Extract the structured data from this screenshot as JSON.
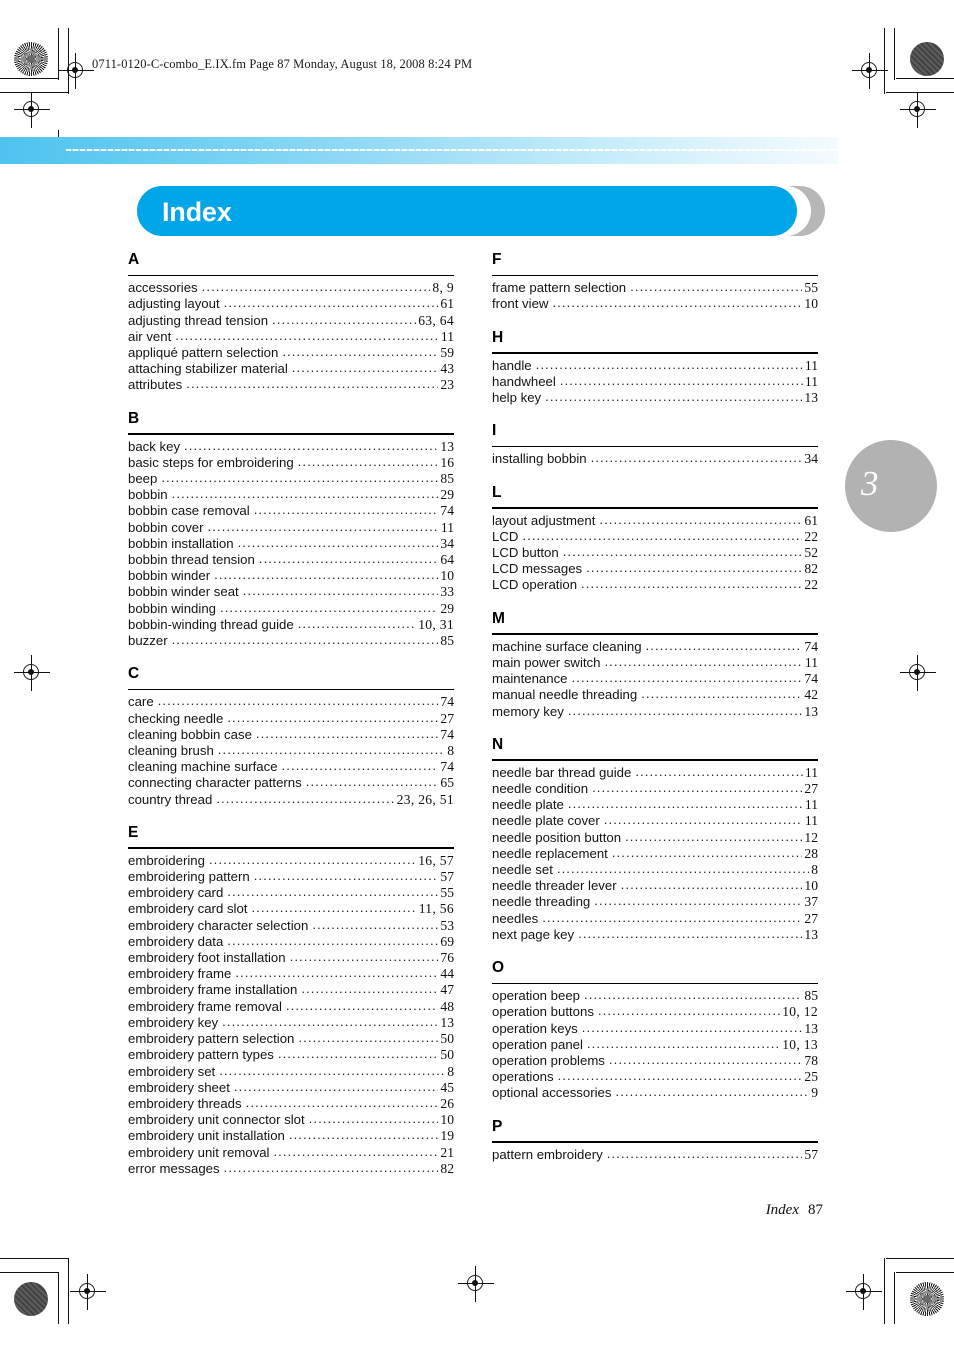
{
  "print_slug": "0711-0120-C-combo_E.IX.fm  Page 87  Monday, August 18, 2008  8:24 PM",
  "title": "Index",
  "chapter_marker": "3",
  "colors": {
    "title_bar": "#00a6e8",
    "title_shadow": "#b7b7b7",
    "gradient_start": "#4dc3ef",
    "gradient_end": "#f3fbfe",
    "chapter_bubble": "#b2b2b2"
  },
  "footer": {
    "label": "Index",
    "page_number": "87"
  },
  "columns": [
    {
      "letters": [
        {
          "letter": "A",
          "entries": [
            {
              "term": "accessories",
              "page": "8, 9"
            },
            {
              "term": "adjusting layout",
              "page": "61"
            },
            {
              "term": "adjusting thread tension",
              "page": "63, 64"
            },
            {
              "term": "air vent",
              "page": "11"
            },
            {
              "term": "appliqué pattern selection",
              "page": "59"
            },
            {
              "term": "attaching stabilizer material",
              "page": "43"
            },
            {
              "term": "attributes",
              "page": "23"
            }
          ]
        },
        {
          "letter": "B",
          "entries": [
            {
              "term": "back key",
              "page": "13"
            },
            {
              "term": "basic steps for embroidering",
              "page": "16"
            },
            {
              "term": "beep",
              "page": "85"
            },
            {
              "term": "bobbin",
              "page": "29"
            },
            {
              "term": "bobbin case removal",
              "page": "74"
            },
            {
              "term": "bobbin cover",
              "page": "11"
            },
            {
              "term": "bobbin installation",
              "page": "34"
            },
            {
              "term": "bobbin thread tension",
              "page": "64"
            },
            {
              "term": "bobbin winder",
              "page": "10"
            },
            {
              "term": "bobbin winder seat",
              "page": "33"
            },
            {
              "term": "bobbin winding",
              "page": "29"
            },
            {
              "term": "bobbin-winding thread guide",
              "page": "10, 31"
            },
            {
              "term": "buzzer",
              "page": "85"
            }
          ]
        },
        {
          "letter": "C",
          "entries": [
            {
              "term": "care",
              "page": "74"
            },
            {
              "term": "checking needle",
              "page": "27"
            },
            {
              "term": "cleaning bobbin case",
              "page": "74"
            },
            {
              "term": "cleaning brush",
              "page": "8"
            },
            {
              "term": "cleaning machine surface",
              "page": "74"
            },
            {
              "term": "connecting character patterns",
              "page": "65"
            },
            {
              "term": "country thread",
              "page": "23, 26, 51"
            }
          ]
        },
        {
          "letter": "E",
          "entries": [
            {
              "term": "embroidering",
              "page": "16, 57"
            },
            {
              "term": "embroidering pattern",
              "page": "57"
            },
            {
              "term": "embroidery card",
              "page": "55"
            },
            {
              "term": "embroidery card slot",
              "page": "11, 56"
            },
            {
              "term": "embroidery character selection",
              "page": "53"
            },
            {
              "term": "embroidery data",
              "page": "69"
            },
            {
              "term": "embroidery foot installation",
              "page": "76"
            },
            {
              "term": "embroidery frame",
              "page": "44"
            },
            {
              "term": "embroidery frame installation",
              "page": "47"
            },
            {
              "term": "embroidery frame removal",
              "page": "48"
            },
            {
              "term": "embroidery key",
              "page": "13"
            },
            {
              "term": "embroidery pattern selection",
              "page": "50"
            },
            {
              "term": "embroidery pattern types",
              "page": "50"
            },
            {
              "term": "embroidery set",
              "page": "8"
            },
            {
              "term": "embroidery sheet",
              "page": "45"
            },
            {
              "term": "embroidery threads",
              "page": "26"
            },
            {
              "term": "embroidery unit connector slot",
              "page": "10"
            },
            {
              "term": "embroidery unit installation",
              "page": "19"
            },
            {
              "term": "embroidery unit removal",
              "page": "21"
            },
            {
              "term": "error messages",
              "page": "82"
            }
          ]
        }
      ]
    },
    {
      "letters": [
        {
          "letter": "F",
          "entries": [
            {
              "term": "frame pattern selection",
              "page": "55"
            },
            {
              "term": "front view",
              "page": "10"
            }
          ]
        },
        {
          "letter": "H",
          "entries": [
            {
              "term": "handle",
              "page": "11"
            },
            {
              "term": "handwheel",
              "page": "11"
            },
            {
              "term": "help key",
              "page": "13"
            }
          ]
        },
        {
          "letter": "I",
          "entries": [
            {
              "term": "installing bobbin",
              "page": "34"
            }
          ]
        },
        {
          "letter": "L",
          "entries": [
            {
              "term": "layout adjustment",
              "page": "61"
            },
            {
              "term": "LCD",
              "page": "22"
            },
            {
              "term": "LCD button",
              "page": "52"
            },
            {
              "term": "LCD messages",
              "page": "82"
            },
            {
              "term": "LCD operation",
              "page": "22"
            }
          ]
        },
        {
          "letter": "M",
          "entries": [
            {
              "term": "machine surface cleaning",
              "page": "74"
            },
            {
              "term": "main power switch",
              "page": "11"
            },
            {
              "term": "maintenance",
              "page": "74"
            },
            {
              "term": "manual needle threading",
              "page": "42"
            },
            {
              "term": "memory key",
              "page": "13"
            }
          ]
        },
        {
          "letter": "N",
          "entries": [
            {
              "term": "needle bar thread guide",
              "page": "11"
            },
            {
              "term": "needle condition",
              "page": "27"
            },
            {
              "term": "needle plate",
              "page": "11"
            },
            {
              "term": "needle plate cover",
              "page": "11"
            },
            {
              "term": "needle position button",
              "page": "12"
            },
            {
              "term": "needle replacement",
              "page": "28"
            },
            {
              "term": "needle set",
              "page": "8"
            },
            {
              "term": "needle threader lever",
              "page": "10"
            },
            {
              "term": "needle threading",
              "page": "37"
            },
            {
              "term": "needles",
              "page": "27"
            },
            {
              "term": "next page key",
              "page": "13"
            }
          ]
        },
        {
          "letter": "O",
          "entries": [
            {
              "term": "operation beep",
              "page": "85"
            },
            {
              "term": "operation buttons",
              "page": "10, 12"
            },
            {
              "term": "operation keys",
              "page": "13"
            },
            {
              "term": "operation panel",
              "page": "10, 13"
            },
            {
              "term": "operation problems",
              "page": "78"
            },
            {
              "term": "operations",
              "page": "25"
            },
            {
              "term": "optional accessories",
              "page": "9"
            }
          ]
        },
        {
          "letter": "P",
          "entries": [
            {
              "term": "pattern embroidery",
              "page": "57"
            }
          ]
        }
      ]
    }
  ]
}
